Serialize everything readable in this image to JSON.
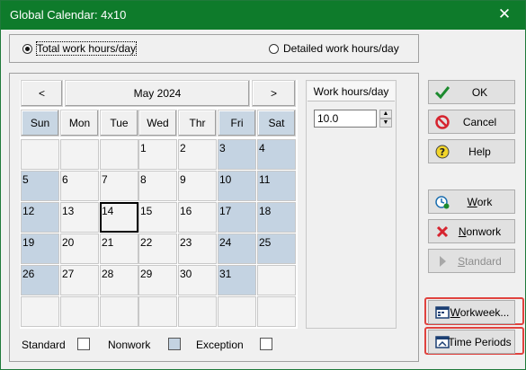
{
  "window": {
    "title": "Global Calendar: 4x10",
    "close_glyph": "✕"
  },
  "mode": {
    "options": [
      {
        "label": "Total work hours/day",
        "selected": true
      },
      {
        "label": "Detailed work hours/day",
        "selected": false
      }
    ]
  },
  "calendar": {
    "prev": "<",
    "next": ">",
    "month": "May 2024",
    "days_of_week": [
      "Sun",
      "Mon",
      "Tue",
      "Wed",
      "Thr",
      "Fri",
      "Sat"
    ],
    "weeks": [
      [
        "",
        "",
        "",
        "1",
        "2",
        "3",
        "4"
      ],
      [
        "5",
        "6",
        "7",
        "8",
        "9",
        "10",
        "11"
      ],
      [
        "12",
        "13",
        "14",
        "15",
        "16",
        "17",
        "18"
      ],
      [
        "19",
        "20",
        "21",
        "22",
        "23",
        "24",
        "25"
      ],
      [
        "26",
        "27",
        "28",
        "29",
        "30",
        "31",
        ""
      ],
      [
        "",
        "",
        "",
        "",
        "",
        "",
        ""
      ]
    ],
    "selected_day": "14",
    "nonwork_columns": [
      "Sun",
      "Fri",
      "Sat"
    ]
  },
  "work_hours": {
    "header": "Work hours/day",
    "value": "10.0"
  },
  "legend": {
    "standard": "Standard",
    "nonwork": "Nonwork",
    "exception": "Exception"
  },
  "buttons": {
    "ok": "OK",
    "cancel": "Cancel",
    "help": "Help",
    "work": "Work",
    "nonwork": "Nonwork",
    "standard": "Standard",
    "workweek": "Workweek...",
    "time_periods": "Time Periods"
  },
  "colors": {
    "titlebar": "#0e7b2b",
    "nonwork_cell": "#c4d3e2",
    "highlight": "#e0433f"
  }
}
